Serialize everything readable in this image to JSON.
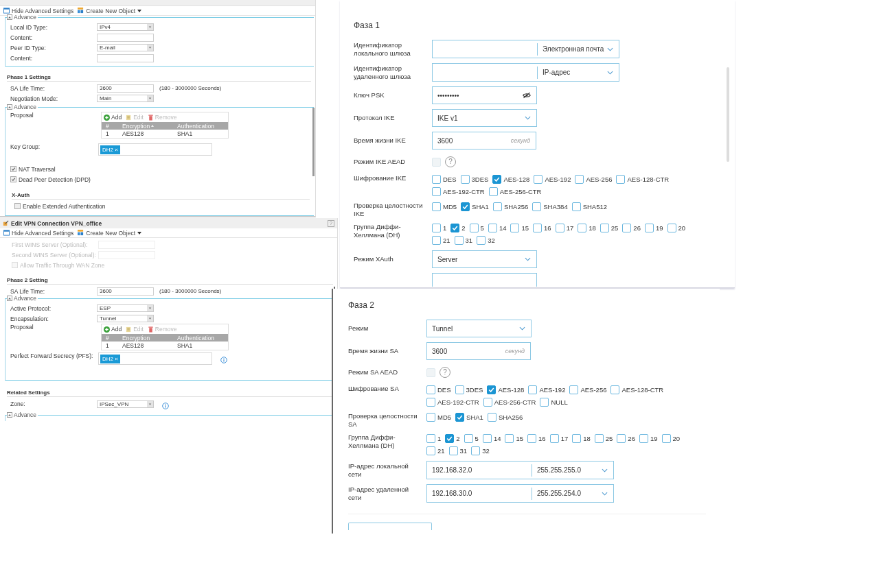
{
  "gateway_window": {
    "toolbar": [
      {
        "label": "Hide Advanced Settings",
        "kind": "hide"
      },
      {
        "label": "Create New Object",
        "kind": "create"
      }
    ],
    "advance_1": {
      "label": "Advance",
      "fields": [
        {
          "label": "Local ID Type:",
          "kind": "select",
          "value": "IPv4"
        },
        {
          "label": "Content:",
          "kind": "input"
        },
        {
          "label": "Peer ID Type:",
          "kind": "select",
          "value": "E-mail"
        },
        {
          "label": "Content:",
          "kind": "input"
        }
      ]
    },
    "phase_1": {
      "title": "Phase 1 Settings",
      "fields": [
        {
          "label": "SA Life Time:",
          "kind": "input",
          "value": "3600",
          "hint": "(180 - 3000000 Seconds)"
        },
        {
          "label": "Negotiation Mode:",
          "kind": "select",
          "value": "Main"
        }
      ]
    },
    "advance_2": {
      "label": "Advance",
      "fields": [
        {
          "label": "Proposal",
          "kind": "proposal",
          "actions": [
            {
              "label": "Add",
              "kind": "add",
              "disabled": false
            },
            {
              "label": "Edit",
              "kind": "edit",
              "disabled": true
            },
            {
              "label": "Remove",
              "kind": "remove",
              "disabled": true
            }
          ],
          "columns": [
            {
              "label": "#",
              "sorted": false
            },
            {
              "label": "Encryption",
              "sorted": true
            },
            {
              "label": "Authentication",
              "sorted": false
            }
          ],
          "rows": [
            [
              "1",
              "AES128",
              "SHA1"
            ]
          ]
        },
        {
          "label": "Key Group:",
          "kind": "tags",
          "tags": [
            "DH2"
          ]
        },
        {
          "label": "NAT Traversal",
          "kind": "checkbox",
          "checked": true
        },
        {
          "label": "Dead Peer Detection (DPD)",
          "kind": "checkbox",
          "checked": true
        }
      ]
    },
    "xauth": {
      "title": "X-Auth",
      "fields": [
        {
          "label": "Enable Extended Authentication",
          "kind": "checkbox",
          "checked": false
        }
      ]
    }
  },
  "connection_window": {
    "title": "Edit VPN Connection VPN_office",
    "help": "?",
    "toolbar": [
      {
        "label": "Hide Advanced Settings",
        "kind": "hide"
      },
      {
        "label": "Create New Object",
        "kind": "create"
      }
    ],
    "top_fields": [
      {
        "label": "First WINS Server (Optional):",
        "kind": "input",
        "disabled": true
      },
      {
        "label": "Second WINS Server (Optional):",
        "kind": "input",
        "disabled": true
      },
      {
        "label": "Allow Traffic Through WAN Zone",
        "kind": "checkbox",
        "checked": false,
        "disabled": true
      }
    ],
    "phase_2": {
      "title": "Phase 2 Setting",
      "fields": [
        {
          "label": "SA Life Time:",
          "kind": "input",
          "value": "3600",
          "hint": "(180 - 3000000 Seconds)"
        }
      ]
    },
    "advance_1": {
      "label": "Advance",
      "fields": [
        {
          "label": "Active Protocol:",
          "kind": "select",
          "value": "ESP",
          "info": false
        },
        {
          "label": "Encapsulation:",
          "kind": "select",
          "value": "Tunnel",
          "info": false
        },
        {
          "label": "Proposal",
          "kind": "proposal",
          "info": false,
          "actions": [
            {
              "label": "Add",
              "kind": "add",
              "disabled": false
            },
            {
              "label": "Edit",
              "kind": "edit",
              "disabled": true
            },
            {
              "label": "Remove",
              "kind": "remove",
              "disabled": true
            }
          ],
          "columns": [
            {
              "label": "#",
              "sorted": false
            },
            {
              "label": "Encryption",
              "sorted": false
            },
            {
              "label": "Authentication",
              "sorted": false
            }
          ],
          "rows": [
            [
              "1",
              "AES128",
              "SHA1"
            ]
          ]
        },
        {
          "label": "Perfect Forward Secrecy (PFS):",
          "kind": "tags",
          "tags": [
            "DH2"
          ],
          "info": true
        }
      ]
    },
    "related": {
      "title": "Related Settings",
      "fields": [
        {
          "label": "Zone:",
          "kind": "select",
          "value": "IPSec_VPN",
          "info": true
        }
      ]
    },
    "advance_2": {
      "label": "Advance"
    }
  },
  "phase_1": {
    "title": "Фаза 1",
    "rows": [
      {
        "label": "Идентификатор локального шлюза",
        "kind": "combo",
        "select": "Электронная почта"
      },
      {
        "label": "Идентификатор удаленного шлюза",
        "kind": "combo",
        "select": "IP-адрес"
      },
      {
        "label": "Ключ PSK",
        "kind": "password",
        "value": "•••••••••"
      },
      {
        "label": "Протокол IKE",
        "kind": "select",
        "value": "IKE v1"
      },
      {
        "label": "Время жизни IKE",
        "kind": "unit",
        "value": "3600",
        "unit": "секунд"
      },
      {
        "label": "Режим IKE AEAD",
        "kind": "aead",
        "checked": false,
        "disabled": true,
        "help": "?"
      },
      {
        "label": "Шифрование IKE",
        "kind": "checks",
        "options": [
          {
            "label": "DES",
            "checked": false
          },
          {
            "label": "3DES",
            "checked": false
          },
          {
            "label": "AES-128",
            "checked": true
          },
          {
            "label": "AES-192",
            "checked": false
          },
          {
            "label": "AES-256",
            "checked": false
          },
          {
            "label": "AES-128-CTR",
            "checked": false
          },
          {
            "label": "AES-192-CTR",
            "checked": false
          },
          {
            "label": "AES-256-CTR",
            "checked": false
          }
        ]
      },
      {
        "label": "Проверка целостности IKE",
        "kind": "checks",
        "options": [
          {
            "label": "MD5",
            "checked": false
          },
          {
            "label": "SHA1",
            "checked": true
          },
          {
            "label": "SHA256",
            "checked": false
          },
          {
            "label": "SHA384",
            "checked": false
          },
          {
            "label": "SHA512",
            "checked": false
          }
        ]
      },
      {
        "label": "Группа Диффи-Хеллмана (DH)",
        "kind": "checks",
        "options": [
          {
            "label": "1",
            "checked": false
          },
          {
            "label": "2",
            "checked": true
          },
          {
            "label": "5",
            "checked": false
          },
          {
            "label": "14",
            "checked": false
          },
          {
            "label": "15",
            "checked": false
          },
          {
            "label": "16",
            "checked": false
          },
          {
            "label": "17",
            "checked": false
          },
          {
            "label": "18",
            "checked": false
          },
          {
            "label": "25",
            "checked": false
          },
          {
            "label": "26",
            "checked": false
          },
          {
            "label": "19",
            "checked": false
          },
          {
            "label": "20",
            "checked": false
          },
          {
            "label": "21",
            "checked": false
          },
          {
            "label": "31",
            "checked": false
          },
          {
            "label": "32",
            "checked": false
          }
        ]
      },
      {
        "label": "Режим XAuth",
        "kind": "select",
        "value": "Server"
      },
      {
        "kind": "cut"
      }
    ]
  },
  "phase_2": {
    "title": "Фаза 2",
    "rows": [
      {
        "label": "Режим",
        "kind": "select",
        "value": "Tunnel"
      },
      {
        "label": "Время жизни SA",
        "kind": "unit",
        "value": "3600",
        "unit": "секунд"
      },
      {
        "label": "Режим SA AEAD",
        "kind": "aead",
        "checked": false,
        "disabled": true,
        "help": "?"
      },
      {
        "label": "Шифрование SA",
        "kind": "checks",
        "options": [
          {
            "label": "DES",
            "checked": false
          },
          {
            "label": "3DES",
            "checked": false
          },
          {
            "label": "AES-128",
            "checked": true
          },
          {
            "label": "AES-192",
            "checked": false
          },
          {
            "label": "AES-256",
            "checked": false
          },
          {
            "label": "AES-128-CTR",
            "checked": false
          },
          {
            "label": "AES-192-CTR",
            "checked": false
          },
          {
            "label": "AES-256-CTR",
            "checked": false
          },
          {
            "label": "NULL",
            "checked": false
          }
        ]
      },
      {
        "label": "Проверка целостности SA",
        "kind": "checks",
        "options": [
          {
            "label": "MD5",
            "checked": false
          },
          {
            "label": "SHA1",
            "checked": true
          },
          {
            "label": "SHA256",
            "checked": false
          }
        ]
      },
      {
        "label": "Группа Диффи-Хеллмана (DH)",
        "kind": "checks",
        "options": [
          {
            "label": "1",
            "checked": false
          },
          {
            "label": "2",
            "checked": true
          },
          {
            "label": "5",
            "checked": false
          },
          {
            "label": "14",
            "checked": false
          },
          {
            "label": "15",
            "checked": false
          },
          {
            "label": "16",
            "checked": false
          },
          {
            "label": "17",
            "checked": false
          },
          {
            "label": "18",
            "checked": false
          },
          {
            "label": "25",
            "checked": false
          },
          {
            "label": "26",
            "checked": false
          },
          {
            "label": "19",
            "checked": false
          },
          {
            "label": "20",
            "checked": false
          },
          {
            "label": "21",
            "checked": false
          },
          {
            "label": "31",
            "checked": false
          },
          {
            "label": "32",
            "checked": false
          }
        ]
      },
      {
        "label": "IP-адрес локальной сети",
        "kind": "combo",
        "value": "192.168.32.0",
        "select": "255.255.255.0"
      },
      {
        "label": "IP-адрес удаленной сети",
        "kind": "combo",
        "value": "192.168.30.0",
        "select": "255.255.254.0"
      }
    ]
  }
}
